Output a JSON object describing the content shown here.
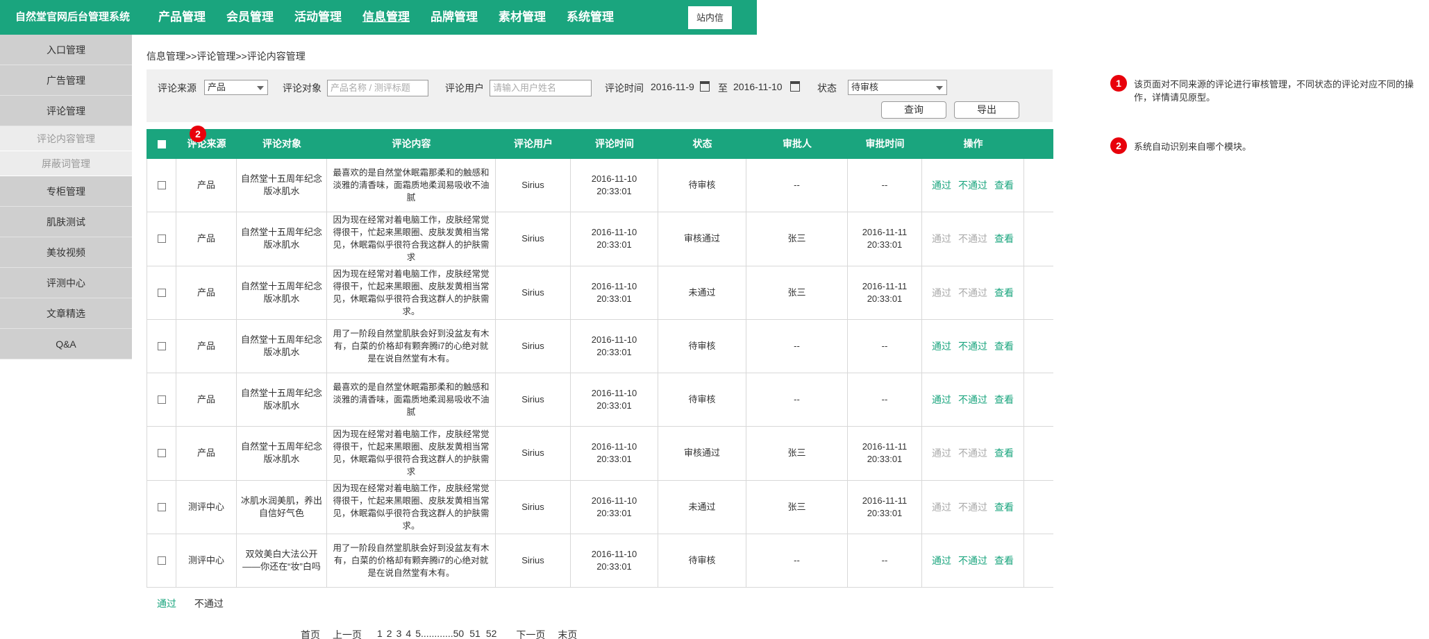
{
  "header": {
    "brand": "自然堂官网后台管理系统",
    "nav": [
      "产品管理",
      "会员管理",
      "活动管理",
      "信息管理",
      "品牌管理",
      "素材管理",
      "系统管理"
    ],
    "active_nav": "信息管理",
    "message_button": "站内信",
    "accent_color": "#1aa57e"
  },
  "sidebar": {
    "items": [
      "入口管理",
      "广告管理",
      "评论管理",
      "评论内容管理",
      "屏蔽词管理",
      "专柜管理",
      "肌肤测试",
      "美妆视频",
      "评测中心",
      "文章精选",
      "Q&A"
    ]
  },
  "breadcrumb": "信息管理>>评论管理>>评论内容管理",
  "filter": {
    "source_label": "评论来源",
    "source_value": "产品",
    "target_label": "评论对象",
    "target_placeholder": "产品名称 / 测评标题",
    "user_label": "评论用户",
    "user_placeholder": "请输入用户姓名",
    "time_label": "评论时间",
    "date_from": "2016-11-9",
    "date_to_sep": "至",
    "date_to": "2016-11-10",
    "status_label": "状态",
    "status_value": "待审核",
    "query_button": "查询",
    "export_button": "导出"
  },
  "table": {
    "headers": [
      "评论来源",
      "评论对象",
      "评论内容",
      "评论用户",
      "评论时间",
      "状态",
      "审批人",
      "审批时间",
      "操作"
    ],
    "actions": {
      "pass": "通过",
      "reject": "不通过",
      "view": "查看"
    },
    "rows": [
      {
        "source": "产品",
        "target": "自然堂十五周年纪念版冰肌水",
        "content": "最喜欢的是自然堂休眠霜那柔和的触感和淡雅的清香味，面霜质地柔润易吸收不油腻",
        "user": "Sirius",
        "date": "2016-11-10",
        "time": "20:33:01",
        "status": "待审核",
        "approver": "--",
        "appr_date": "--",
        "appr_time": ""
      },
      {
        "source": "产品",
        "target": "自然堂十五周年纪念版冰肌水",
        "content": "因为现在经常对着电脑工作，皮肤经常觉得很干，忙起来黑眼圈、皮肤发黄相当常见，休眠霜似乎很符合我这群人的护肤需求",
        "user": "Sirius",
        "date": "2016-11-10",
        "time": "20:33:01",
        "status": "审核通过",
        "approver": "张三",
        "appr_date": "2016-11-11",
        "appr_time": "20:33:01"
      },
      {
        "source": "产品",
        "target": "自然堂十五周年纪念版冰肌水",
        "content": "因为现在经常对着电脑工作，皮肤经常觉得很干，忙起来黑眼圈、皮肤发黄相当常见，休眠霜似乎很符合我这群人的护肤需求。",
        "user": "Sirius",
        "date": "2016-11-10",
        "time": "20:33:01",
        "status": "未通过",
        "approver": "张三",
        "appr_date": "2016-11-11",
        "appr_time": "20:33:01"
      },
      {
        "source": "产品",
        "target": "自然堂十五周年纪念版冰肌水",
        "content": "用了一阶段自然堂肌肤会好到没盆友有木有，白菜的价格却有颗奔腾i7的心绝对就是在说自然堂有木有。",
        "user": "Sirius",
        "date": "2016-11-10",
        "time": "20:33:01",
        "status": "待审核",
        "approver": "--",
        "appr_date": "--",
        "appr_time": ""
      },
      {
        "source": "产品",
        "target": "自然堂十五周年纪念版冰肌水",
        "content": "最喜欢的是自然堂休眠霜那柔和的触感和淡雅的清香味，面霜质地柔润易吸收不油腻",
        "user": "Sirius",
        "date": "2016-11-10",
        "time": "20:33:01",
        "status": "待审核",
        "approver": "--",
        "appr_date": "--",
        "appr_time": ""
      },
      {
        "source": "产品",
        "target": "自然堂十五周年纪念版冰肌水",
        "content": "因为现在经常对着电脑工作，皮肤经常觉得很干，忙起来黑眼圈、皮肤发黄相当常见，休眠霜似乎很符合我这群人的护肤需求",
        "user": "Sirius",
        "date": "2016-11-10",
        "time": "20:33:01",
        "status": "审核通过",
        "approver": "张三",
        "appr_date": "2016-11-11",
        "appr_time": "20:33:01"
      },
      {
        "source": "测评中心",
        "target": "冰肌水润美肌，养出自信好气色",
        "content": "因为现在经常对着电脑工作，皮肤经常觉得很干，忙起来黑眼圈、皮肤发黄相当常见，休眠霜似乎很符合我这群人的护肤需求。",
        "user": "Sirius",
        "date": "2016-11-10",
        "time": "20:33:01",
        "status": "未通过",
        "approver": "张三",
        "appr_date": "2016-11-11",
        "appr_time": "20:33:01"
      },
      {
        "source": "测评中心",
        "target": "双效美白大法公开——你还在“妆”白吗",
        "content": "用了一阶段自然堂肌肤会好到没盆友有木有，白菜的价格却有颗奔腾i7的心绝对就是在说自然堂有木有。",
        "user": "Sirius",
        "date": "2016-11-10",
        "time": "20:33:01",
        "status": "待审核",
        "approver": "--",
        "appr_date": "--",
        "appr_time": ""
      }
    ]
  },
  "batch": {
    "pass": "通过",
    "reject": "不通过"
  },
  "pager": {
    "first": "首页",
    "prev": "上一页",
    "pages": [
      "1",
      "2",
      "3",
      "4",
      "5............50",
      "51",
      "52"
    ],
    "next": "下一页",
    "last": "末页"
  },
  "notes": [
    {
      "num": "1",
      "text": "该页面对不同来源的评论进行审核管理，不同状态的评论对应不同的操作，详情请见原型。"
    },
    {
      "num": "2",
      "text": "系统自动识别来自哪个模块。"
    }
  ]
}
